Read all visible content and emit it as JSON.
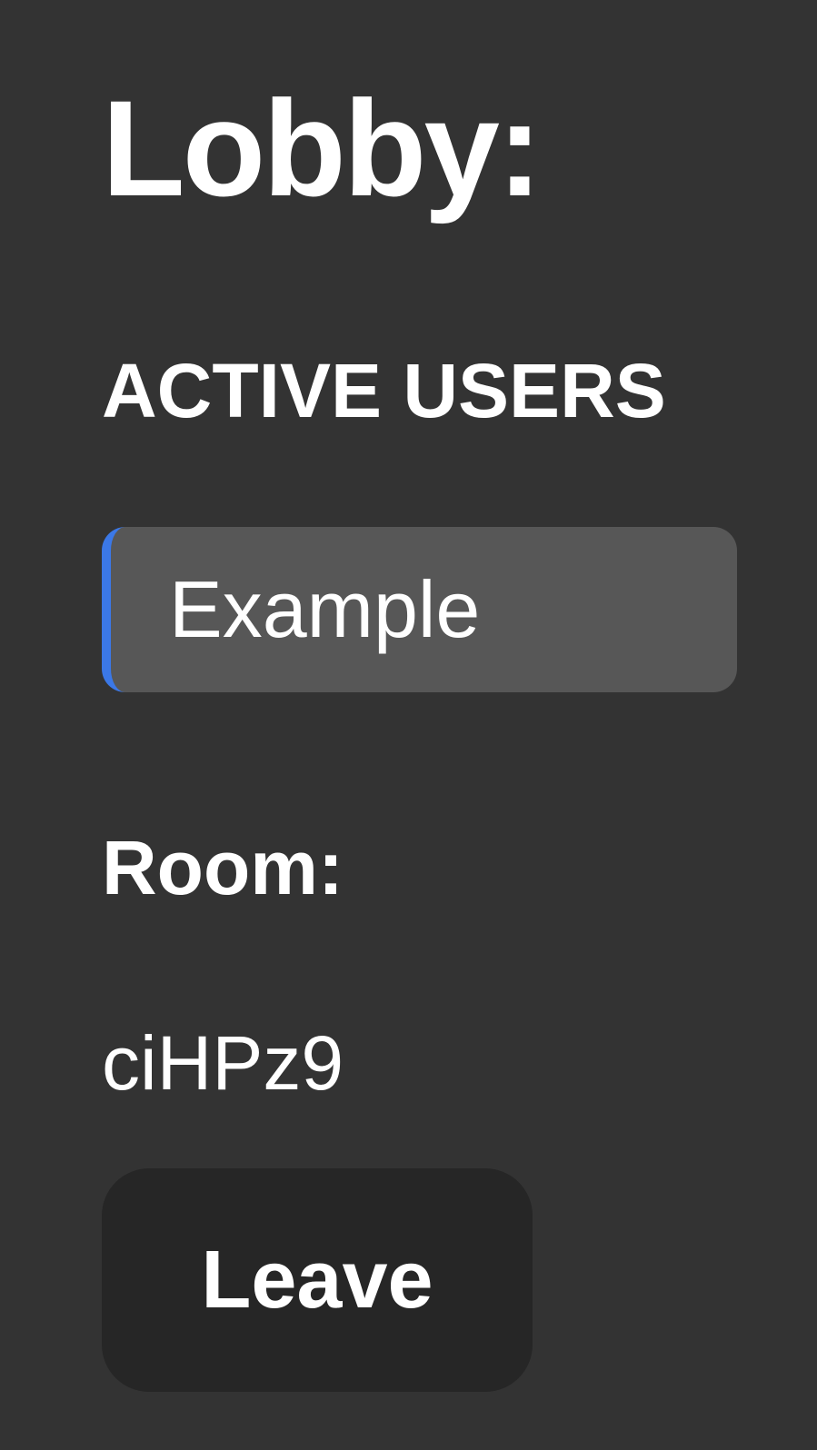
{
  "lobby": {
    "title": "Lobby:"
  },
  "active_users": {
    "heading": "ACTIVE USERS",
    "users": [
      {
        "name": "Example"
      }
    ]
  },
  "room": {
    "label": "Room:",
    "code": "ciHPz9"
  },
  "actions": {
    "leave_label": "Leave"
  },
  "colors": {
    "background": "#333333",
    "user_card": "#575757",
    "accent": "#3b78e7",
    "button": "#262626",
    "text": "#ffffff"
  }
}
